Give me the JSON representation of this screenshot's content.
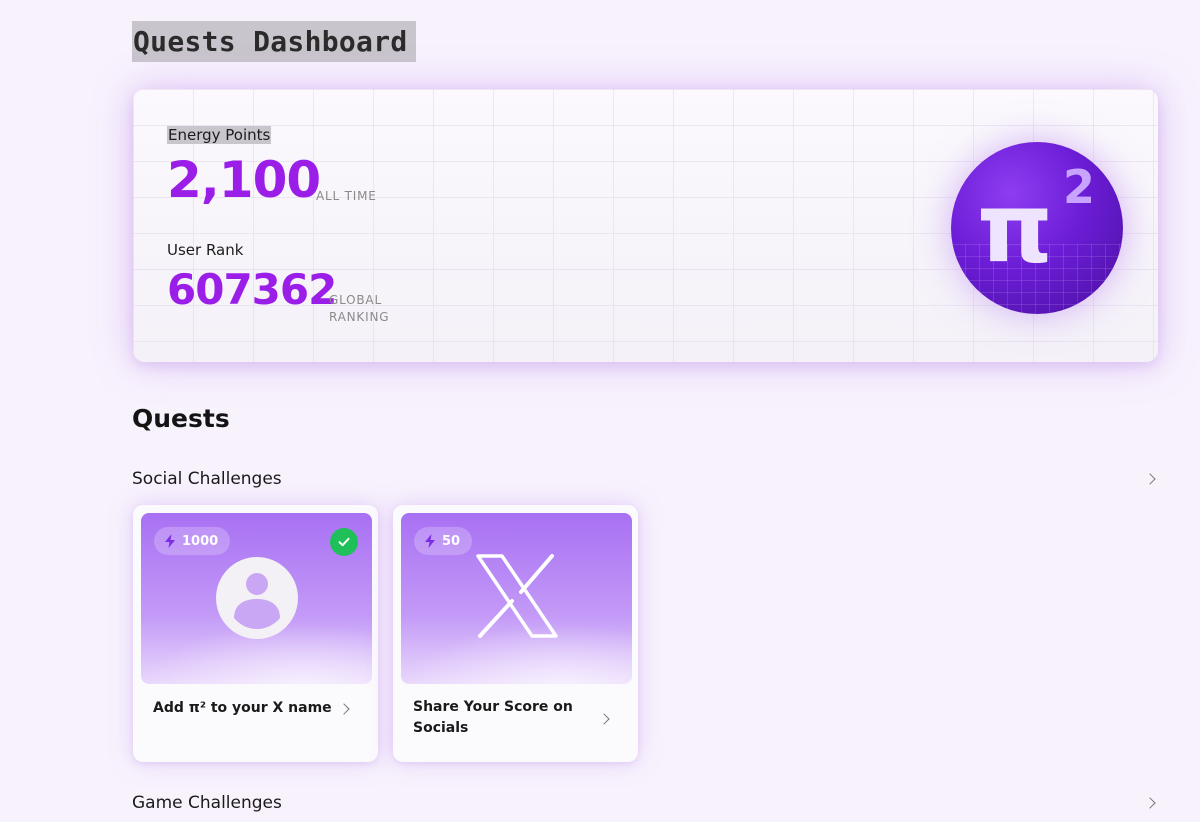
{
  "page": {
    "title": "Quests Dashboard"
  },
  "stats": {
    "energy": {
      "label": "Energy Points",
      "value": "2,100",
      "caption": "ALL TIME"
    },
    "rank": {
      "label": "User Rank",
      "value": "607362",
      "caption_line1": "GLOBAL",
      "caption_line2": "RANKING"
    },
    "logo": {
      "symbol": "π",
      "superscript": "2"
    }
  },
  "quests": {
    "section_title": "Quests",
    "categories": [
      {
        "label": "Social Challenges",
        "cards": [
          {
            "points": "1000",
            "title": "Add π² to your X name",
            "completed": true,
            "icon": "user-avatar-icon"
          },
          {
            "points": "50",
            "title": "Share Your Score on Socials",
            "completed": false,
            "icon": "x-logo-icon"
          }
        ]
      },
      {
        "label": "Game Challenges",
        "cards": []
      }
    ]
  },
  "colors": {
    "accent": "#9b1ee8",
    "background": "#f8f2fd",
    "card_gradient_top": "#a870f3",
    "success": "#1fc05a"
  }
}
